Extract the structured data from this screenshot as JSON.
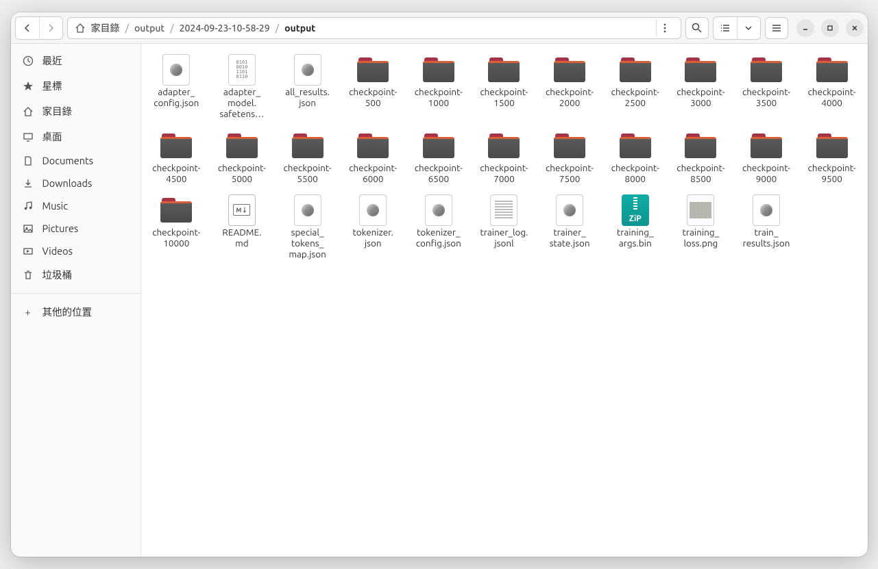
{
  "breadcrumb": {
    "home_label": "家目錄",
    "segments": [
      "output",
      "2024-09-23-10-58-29",
      "output"
    ]
  },
  "sidebar": {
    "items": [
      {
        "icon": "clock",
        "label": "最近"
      },
      {
        "icon": "star",
        "label": "星標"
      },
      {
        "icon": "home",
        "label": "家目錄"
      },
      {
        "icon": "desktop",
        "label": "桌面"
      },
      {
        "icon": "documents",
        "label": "Documents"
      },
      {
        "icon": "downloads",
        "label": "Downloads"
      },
      {
        "icon": "music",
        "label": "Music"
      },
      {
        "icon": "pictures",
        "label": "Pictures"
      },
      {
        "icon": "videos",
        "label": "Videos"
      },
      {
        "icon": "trash",
        "label": "垃圾桶"
      }
    ],
    "other_label": "其他的位置"
  },
  "files": [
    {
      "type": "json",
      "label": "adapter_\nconfig.json"
    },
    {
      "type": "binary",
      "label": "adapter_\nmodel.\nsafetens…"
    },
    {
      "type": "json",
      "label": "all_results.\njson"
    },
    {
      "type": "folder",
      "label": "checkpoint-\n500"
    },
    {
      "type": "folder",
      "label": "checkpoint-\n1000"
    },
    {
      "type": "folder",
      "label": "checkpoint-\n1500"
    },
    {
      "type": "folder",
      "label": "checkpoint-\n2000"
    },
    {
      "type": "folder",
      "label": "checkpoint-\n2500"
    },
    {
      "type": "folder",
      "label": "checkpoint-\n3000"
    },
    {
      "type": "folder",
      "label": "checkpoint-\n3500"
    },
    {
      "type": "folder",
      "label": "checkpoint-\n4000"
    },
    {
      "type": "folder",
      "label": "checkpoint-\n4500"
    },
    {
      "type": "folder",
      "label": "checkpoint-\n5000"
    },
    {
      "type": "folder",
      "label": "checkpoint-\n5500"
    },
    {
      "type": "folder",
      "label": "checkpoint-\n6000"
    },
    {
      "type": "folder",
      "label": "checkpoint-\n6500"
    },
    {
      "type": "folder",
      "label": "checkpoint-\n7000"
    },
    {
      "type": "folder",
      "label": "checkpoint-\n7500"
    },
    {
      "type": "folder",
      "label": "checkpoint-\n8000"
    },
    {
      "type": "folder",
      "label": "checkpoint-\n8500"
    },
    {
      "type": "folder",
      "label": "checkpoint-\n9000"
    },
    {
      "type": "folder",
      "label": "checkpoint-\n9500"
    },
    {
      "type": "folder",
      "label": "checkpoint-\n10000"
    },
    {
      "type": "md",
      "label": "README.\nmd"
    },
    {
      "type": "json",
      "label": "special_\ntokens_\nmap.json"
    },
    {
      "type": "json",
      "label": "tokenizer.\njson"
    },
    {
      "type": "json",
      "label": "tokenizer_\nconfig.json"
    },
    {
      "type": "txt",
      "label": "trainer_log.\njsonl"
    },
    {
      "type": "json",
      "label": "trainer_\nstate.json"
    },
    {
      "type": "zip",
      "label": "training_\nargs.bin"
    },
    {
      "type": "png",
      "label": "training_\nloss.png"
    },
    {
      "type": "json",
      "label": "train_\nresults.json"
    }
  ]
}
